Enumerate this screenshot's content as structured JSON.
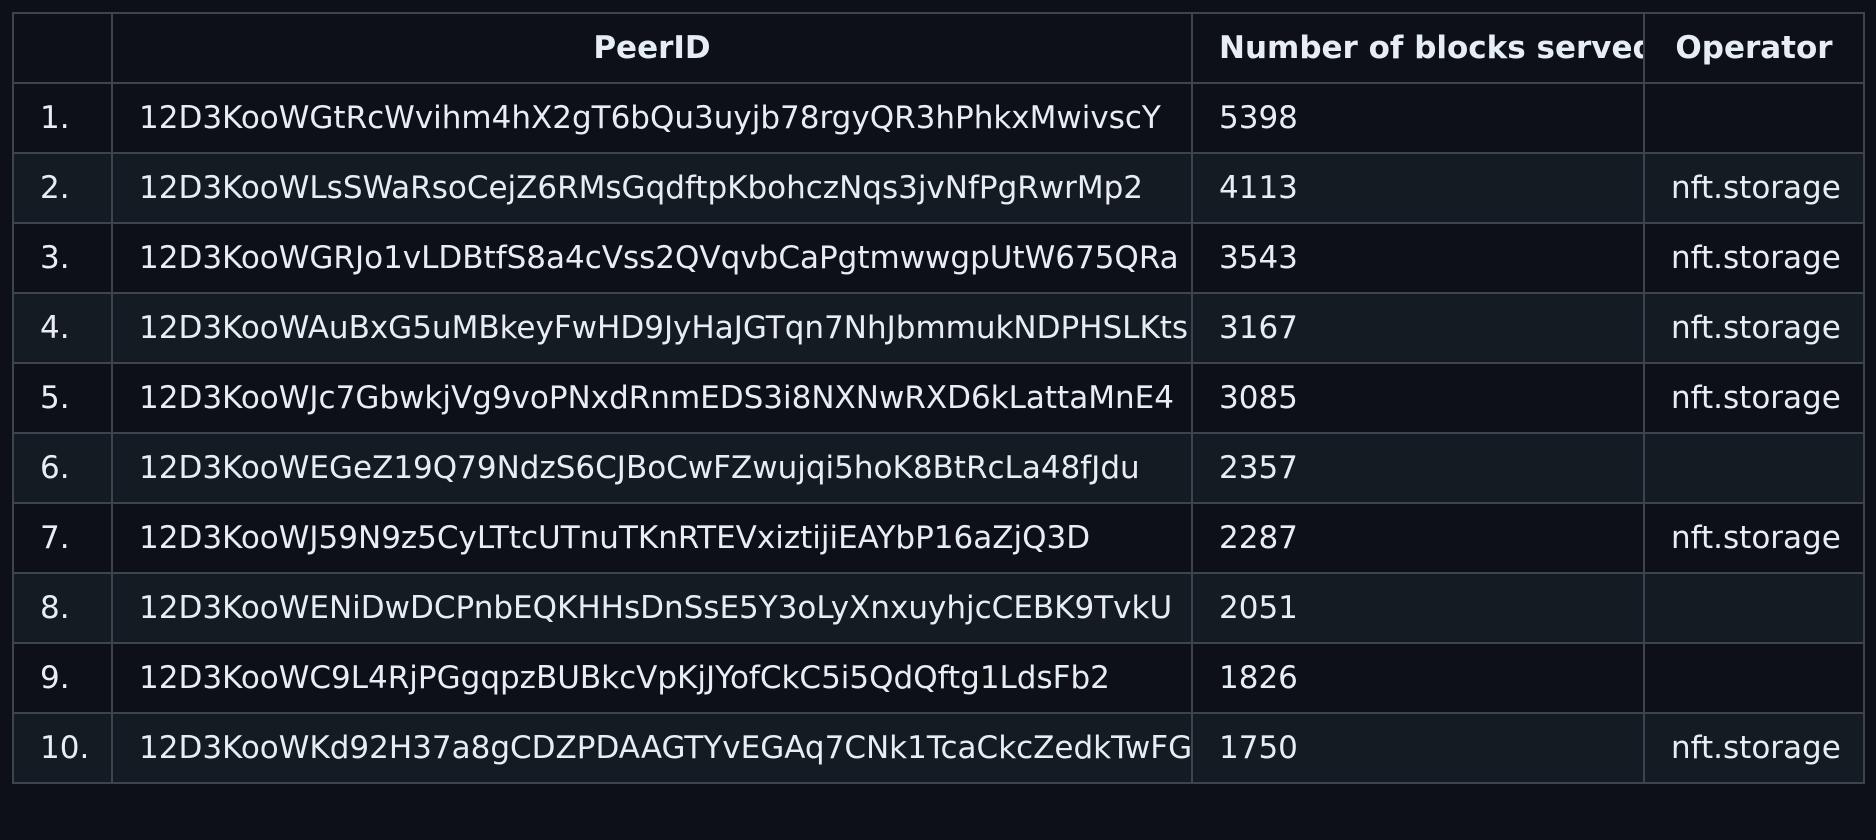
{
  "table": {
    "headers": {
      "index": "",
      "peer_id": "PeerID",
      "blocks": "Number of blocks served",
      "operator": "Operator"
    },
    "rows": [
      {
        "index": "1.",
        "peer_id": "12D3KooWGtRcWvihm4hX2gT6bQu3uyjb78rgyQR3hPhkxMwivscY",
        "blocks": "5398",
        "operator": ""
      },
      {
        "index": "2.",
        "peer_id": "12D3KooWLsSWaRsoCejZ6RMsGqdftpKbohczNqs3jvNfPgRwrMp2",
        "blocks": "4113",
        "operator": "nft.storage"
      },
      {
        "index": "3.",
        "peer_id": "12D3KooWGRJo1vLDBtfS8a4cVss2QVqvbCaPgtmwwgpUtW675QRa",
        "blocks": "3543",
        "operator": "nft.storage"
      },
      {
        "index": "4.",
        "peer_id": "12D3KooWAuBxG5uMBkeyFwHD9JyHaJGTqn7NhJbmmukNDPHSLKts",
        "blocks": "3167",
        "operator": "nft.storage"
      },
      {
        "index": "5.",
        "peer_id": "12D3KooWJc7GbwkjVg9voPNxdRnmEDS3i8NXNwRXD6kLattaMnE4",
        "blocks": "3085",
        "operator": "nft.storage"
      },
      {
        "index": "6.",
        "peer_id": "12D3KooWEGeZ19Q79NdzS6CJBoCwFZwujqi5hoK8BtRcLa48fJdu",
        "blocks": "2357",
        "operator": ""
      },
      {
        "index": "7.",
        "peer_id": "12D3KooWJ59N9z5CyLTtcUTnuTKnRTEVxiztijiEAYbP16aZjQ3D",
        "blocks": "2287",
        "operator": "nft.storage"
      },
      {
        "index": "8.",
        "peer_id": "12D3KooWENiDwDCPnbEQKHHsDnSsE5Y3oLyXnxuyhjcCEBK9TvkU",
        "blocks": "2051",
        "operator": ""
      },
      {
        "index": "9.",
        "peer_id": "12D3KooWC9L4RjPGgqpzBUBkcVpKjJYofCkC5i5QdQftg1LdsFb2",
        "blocks": "1826",
        "operator": ""
      },
      {
        "index": "10.",
        "peer_id": "12D3KooWKd92H37a8gCDZPDAAGTYvEGAq7CNk1TcaCkcZedkTwFG",
        "blocks": "1750",
        "operator": "nft.storage"
      }
    ]
  }
}
